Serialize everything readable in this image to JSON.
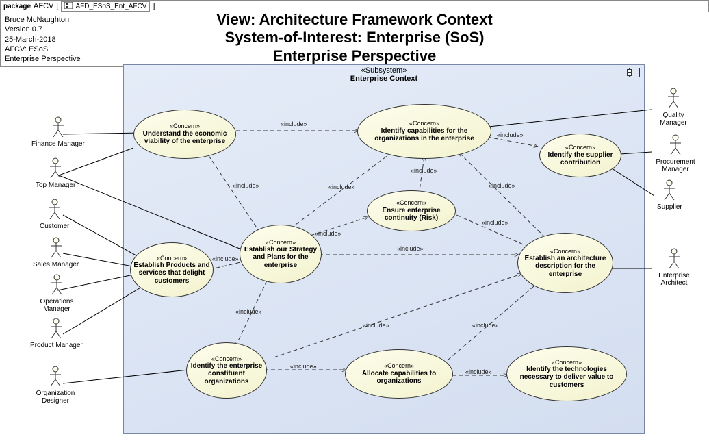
{
  "package_label": "package",
  "package_name": "AFCV",
  "diagram_ref": "AFD_ESoS_Ent_AFCV",
  "info": {
    "author": "Bruce McNaughton",
    "version": "Version 0.7",
    "date": "25-March-2018",
    "afcv": "AFCV: ESoS",
    "perspective": "Enterprise Perspective"
  },
  "title": {
    "line1": "View: Architecture Framework Context",
    "line2": "System-of-Interest: Enterprise (SoS)",
    "line3": "Enterprise Perspective"
  },
  "subsystem": {
    "stereotype": "«Subsystem»",
    "name": "Enterprise Context"
  },
  "concern_stereotype": "«Concern»",
  "concerns": {
    "c1": "Understand the economic viability of the enterprise",
    "c2": "Identify capabilities for the organizations in the enterprise",
    "c3": "Identify the supplier contribution",
    "c4": "Ensure enterprise continuity (Risk)",
    "c5": "Establish our Strategy and Plans for the enterprise",
    "c6": "Establish Products and services that delight customers",
    "c7": "Establish an architecture description for the enterprise",
    "c8": "Identify the enterprise constituent organizations",
    "c9": "Allocate capabilities to organizations",
    "c10": "Identify the technologies necessary to deliver value to customers"
  },
  "actors": {
    "finance": "Finance Manager",
    "top": "Top Manager",
    "customer": "Customer",
    "sales": "Sales Manager",
    "ops": "Operations Manager",
    "product": "Product Manager",
    "orgdes": "Organization Designer",
    "quality": "Quality Manager",
    "procurement": "Procurement Manager",
    "supplier": "Supplier",
    "entarch": "Enterprise Architect"
  },
  "include_label": "«include»"
}
